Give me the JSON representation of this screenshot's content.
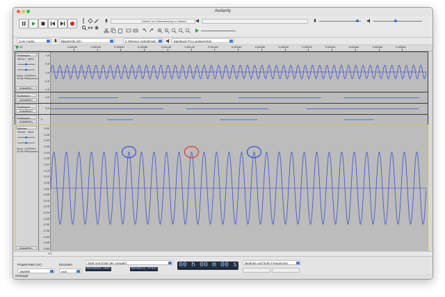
{
  "window": {
    "title": "Audacity"
  },
  "toolbar": {
    "tools": [
      {
        "name": "pause-button",
        "icon": "pause-icon"
      },
      {
        "name": "play-button",
        "icon": "play-icon"
      },
      {
        "name": "stop-button",
        "icon": "stop-icon"
      },
      {
        "name": "skip-start-button",
        "icon": "skip-start-icon"
      },
      {
        "name": "skip-end-button",
        "icon": "skip-end-icon"
      },
      {
        "name": "record-button",
        "icon": "record-icon"
      }
    ],
    "meter_tooltip": "Klicken um Überwachung zu starten",
    "meter_ticks": [
      "-54",
      "-48",
      "-42",
      "-36",
      "-30",
      "-24",
      "-18",
      "-12",
      "-6",
      "0"
    ],
    "record_ticks": [
      "-54",
      "-48",
      "-42",
      "-36",
      "-30",
      "-24",
      "-18",
      "-12",
      "-6",
      "0"
    ]
  },
  "devices": {
    "host": "Core Audio",
    "input": "BlackHole 2ch",
    "channels": "2 (Stereo) Aufnahmek...",
    "output": "MacBook Pro Lautsprecher"
  },
  "ruler": {
    "start_label": "30",
    "ticks": [
      "0,00020",
      "0,00040",
      "0,00060",
      "0,00080",
      "0,00100",
      "0,00120",
      "0,00140",
      "0,00160",
      "0,00180",
      "0,00200",
      "0,00220",
      "0,00240",
      "0,00260",
      "0,00280",
      "0,00300"
    ]
  },
  "tracks": [
    {
      "name": "Audiospur",
      "mute": "Stumm",
      "solo": "Allein",
      "info": "Mono, 192000Hz\n32-Bit-Fließkomma",
      "select": "Auswählen",
      "scale": [
        "1,0",
        "0,5",
        "0,0",
        "-0,5",
        "-1,0"
      ],
      "amplitude": 0.17,
      "cycles": 52
    },
    {
      "name": "Audiospur",
      "select": "Auswählen",
      "scale": [
        "0,0"
      ]
    },
    {
      "name": "Audiospur",
      "select": "Auswählen",
      "scale": [
        "0,0"
      ]
    },
    {
      "name": "Audiospur",
      "select": "Auswählen",
      "scale": [
        "0"
      ]
    },
    {
      "name": "Wecker",
      "mute": "Stumm",
      "solo": "Allein",
      "info": "Mono, 192000Hz\n32-Bit-Fließkomma",
      "select": "Auswählen",
      "scale": [
        "0,50",
        "0,45",
        "0,40",
        "0,35",
        "0,30",
        "0,25",
        "0,20",
        "0,15",
        "0,10",
        "0,05",
        "0,00",
        "-0,05",
        "-0,10",
        "-0,15",
        "-0,20",
        "-0,25",
        "-0,30",
        "-0,35",
        "-0,40",
        "-0,45",
        "-0,50"
      ],
      "amplitude": 0.3,
      "cycles": 30
    }
  ],
  "annotations": [
    {
      "color": "#2d4fd6",
      "cycle": 6
    },
    {
      "color": "#e03a2a",
      "cycle": 11
    },
    {
      "color": "#2d4fd6",
      "cycle": 16
    }
  ],
  "bottom": {
    "rate_label": "Projekt-Rate (Hz)",
    "rate_value": "192000",
    "snap_label": "Einrasten",
    "snap_value": "Aus",
    "selection_mode": "Start und Ende der Auswahl",
    "sel_start": "00h00m00,000s",
    "sel_end": "00h00m22,6762s",
    "time": "00 h 00 m 00 s",
    "freq_label": "Niedrige und hohe Frequenzen"
  },
  "status": "Gestoppt"
}
